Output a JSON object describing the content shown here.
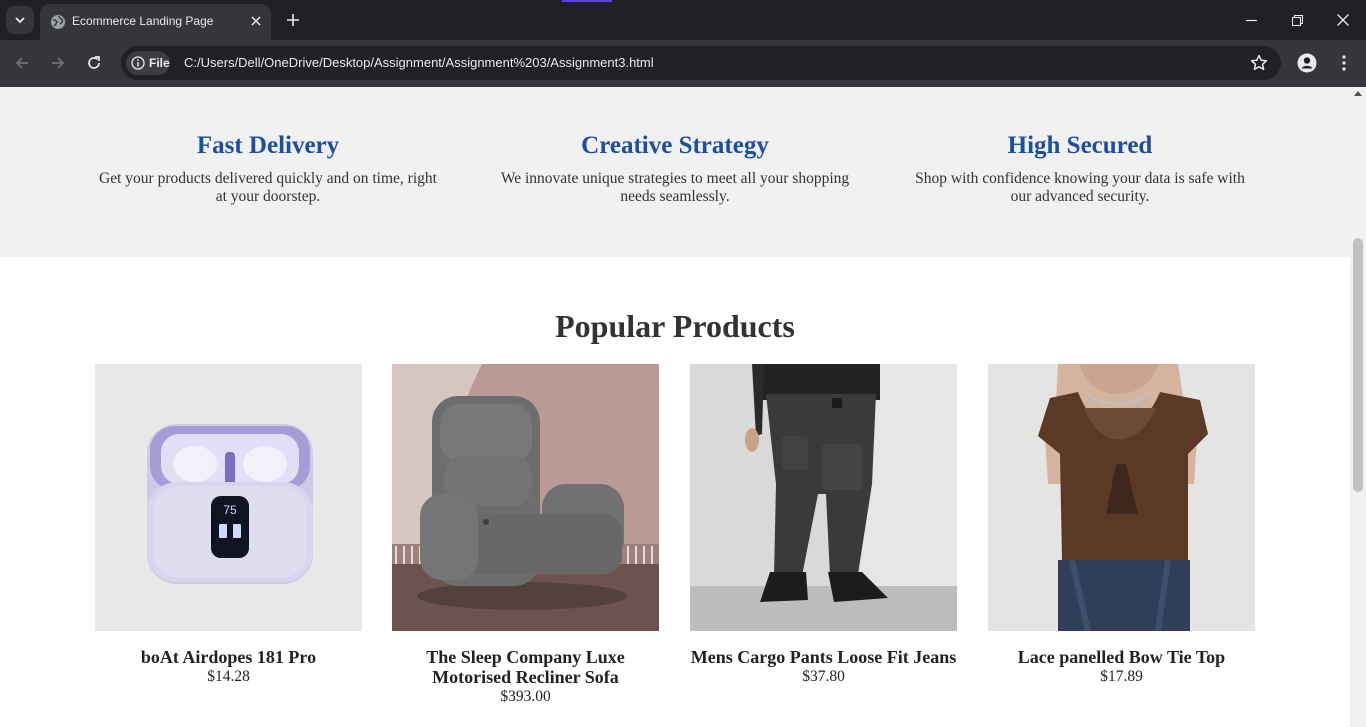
{
  "browser": {
    "tab_title": "Ecommerce Landing Page",
    "file_chip_label": "File",
    "url": "C:/Users/Dell/OneDrive/Desktop/Assignment/Assignment%203/Assignment3.html"
  },
  "features": [
    {
      "title": "Fast Delivery",
      "description": "Get your products delivered quickly and on time, right at your doorstep."
    },
    {
      "title": "Creative Strategy",
      "description": "We innovate unique strategies to meet all your shopping needs seamlessly."
    },
    {
      "title": "High Secured",
      "description": "Shop with confidence knowing your data is safe with our advanced security."
    }
  ],
  "popular": {
    "title": "Popular Products",
    "products": [
      {
        "name": "boAt Airdopes 181 Pro",
        "price": "$14.28",
        "case_display": "75"
      },
      {
        "name": "The Sleep Company Luxe Motorised Recliner Sofa",
        "price": "$393.00"
      },
      {
        "name": "Mens Cargo Pants Loose Fit Jeans",
        "price": "$37.80"
      },
      {
        "name": "Lace panelled Bow Tie Top",
        "price": "$17.89"
      }
    ]
  },
  "colors": {
    "feature_title": "#1d4fa0",
    "chrome_dark": "#202124",
    "chrome_mid": "#35363a"
  }
}
